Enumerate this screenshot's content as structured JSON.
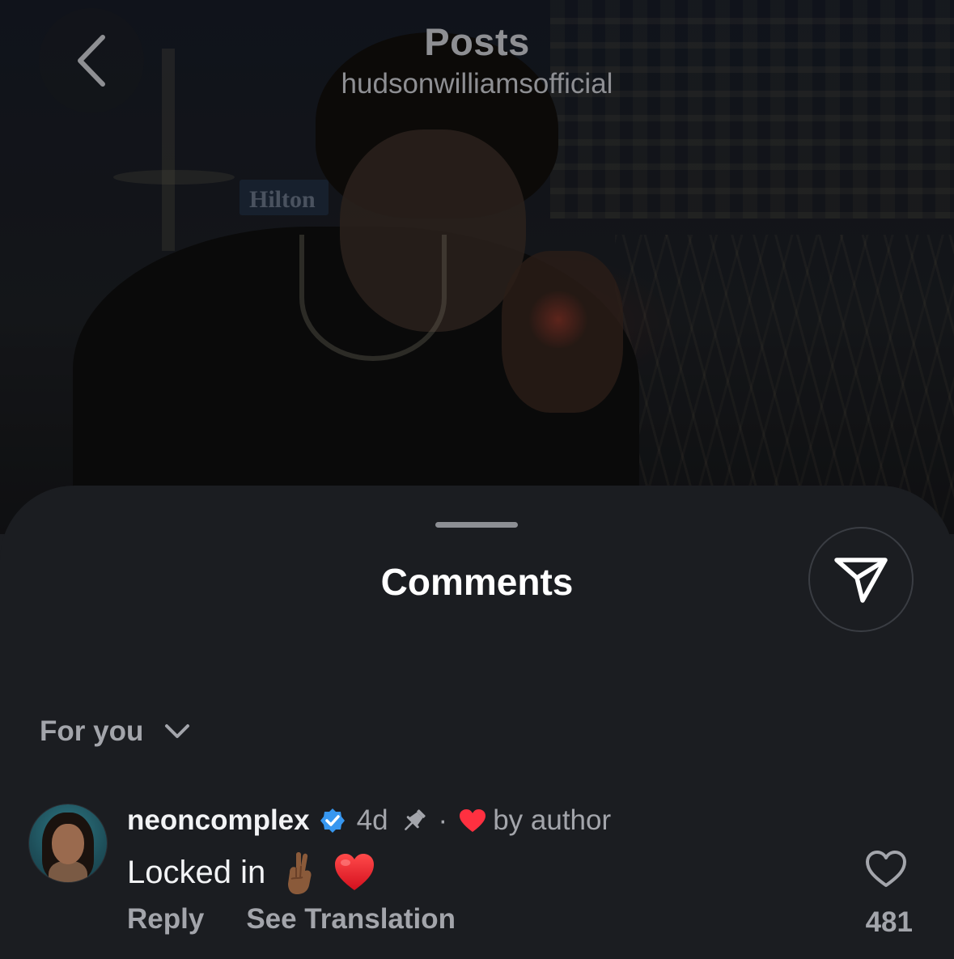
{
  "header": {
    "title": "Posts",
    "subtitle": "hudsonwilliamsofficial"
  },
  "photo": {
    "sign_text": "Hilton"
  },
  "sheet": {
    "title": "Comments",
    "filter_label": "For you"
  },
  "comment": {
    "username": "neoncomplex",
    "time": "4d",
    "separator": "·",
    "liked_by_author": "by author",
    "text": "Locked in",
    "emojis": [
      "crossed-fingers-medium-dark-skin-tone",
      "red-heart"
    ],
    "reply_label": "Reply",
    "translate_label": "See Translation",
    "like_count": "481"
  },
  "colors": {
    "sheet_background": "#1b1d21",
    "verified_blue": "#3797f0",
    "heart_red": "#ff3040",
    "secondary_text": "#a3a5ab"
  },
  "icons": {
    "back": "chevron-left-icon",
    "share": "paper-plane-icon",
    "filter": "chevron-down-icon",
    "verified": "verified-badge-icon",
    "pinned": "pin-icon",
    "author_like": "heart-filled-icon",
    "like": "heart-outline-icon"
  }
}
